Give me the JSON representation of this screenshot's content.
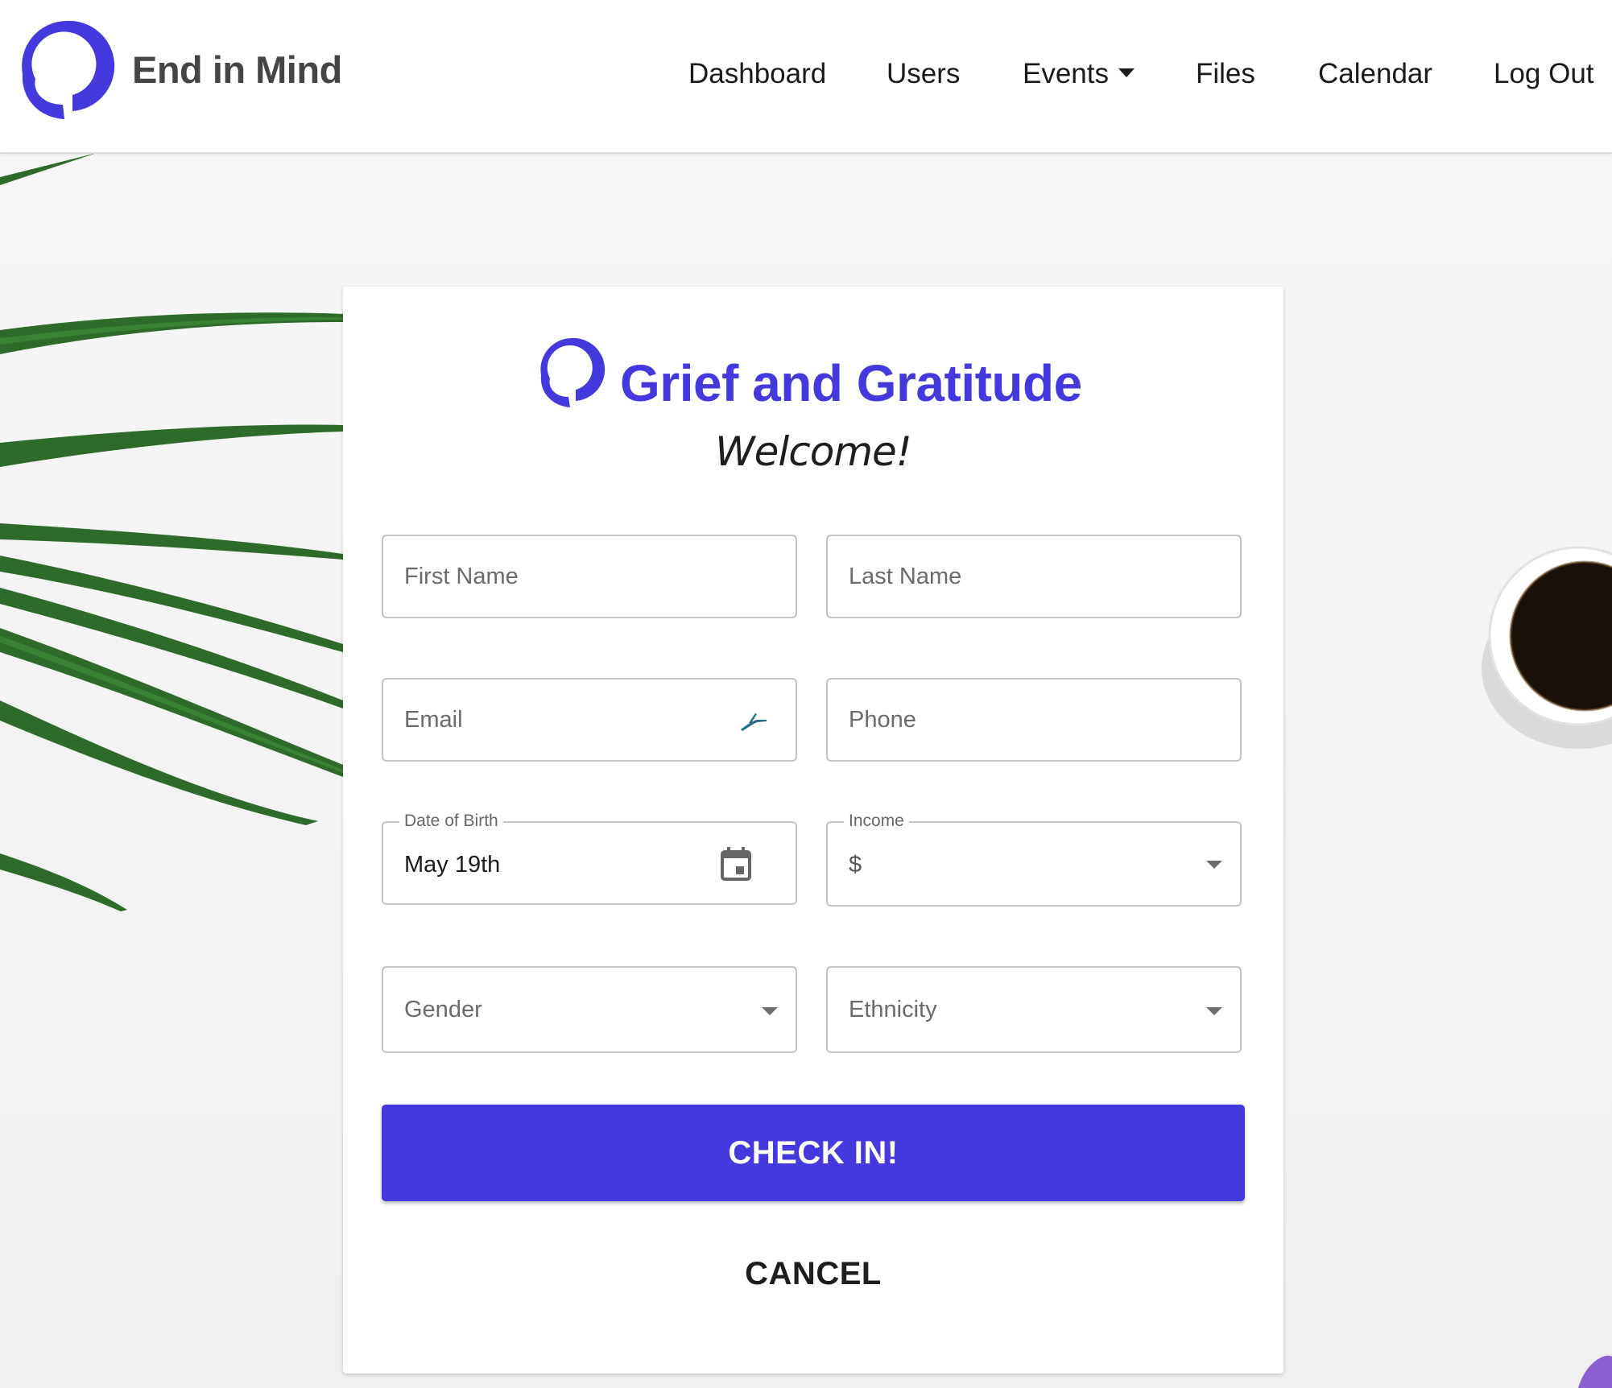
{
  "app": {
    "brand_name": "End in Mind",
    "accent_color": "#4339dc"
  },
  "nav": {
    "items": [
      {
        "label": "Dashboard"
      },
      {
        "label": "Users"
      },
      {
        "label": "Events",
        "has_dropdown": true
      },
      {
        "label": "Files"
      },
      {
        "label": "Calendar"
      },
      {
        "label": "Log Out"
      }
    ]
  },
  "form": {
    "title": "Grief and Gratitude",
    "subtitle": "Welcome!",
    "first_name": {
      "placeholder": "First Name"
    },
    "last_name": {
      "placeholder": "Last Name"
    },
    "email": {
      "placeholder": "Email",
      "icon": "autofill-extension-icon"
    },
    "phone": {
      "placeholder": "Phone"
    },
    "dob": {
      "label": "Date of Birth",
      "value": "May 19th",
      "icon": "calendar-icon"
    },
    "income": {
      "label": "Income",
      "value": "$",
      "icon": "chevron-down-icon"
    },
    "gender": {
      "placeholder": "Gender",
      "icon": "chevron-down-icon"
    },
    "ethnicity": {
      "placeholder": "Ethnicity",
      "icon": "chevron-down-icon"
    },
    "submit_label": "CHECK IN!",
    "cancel_label": "CANCEL"
  }
}
